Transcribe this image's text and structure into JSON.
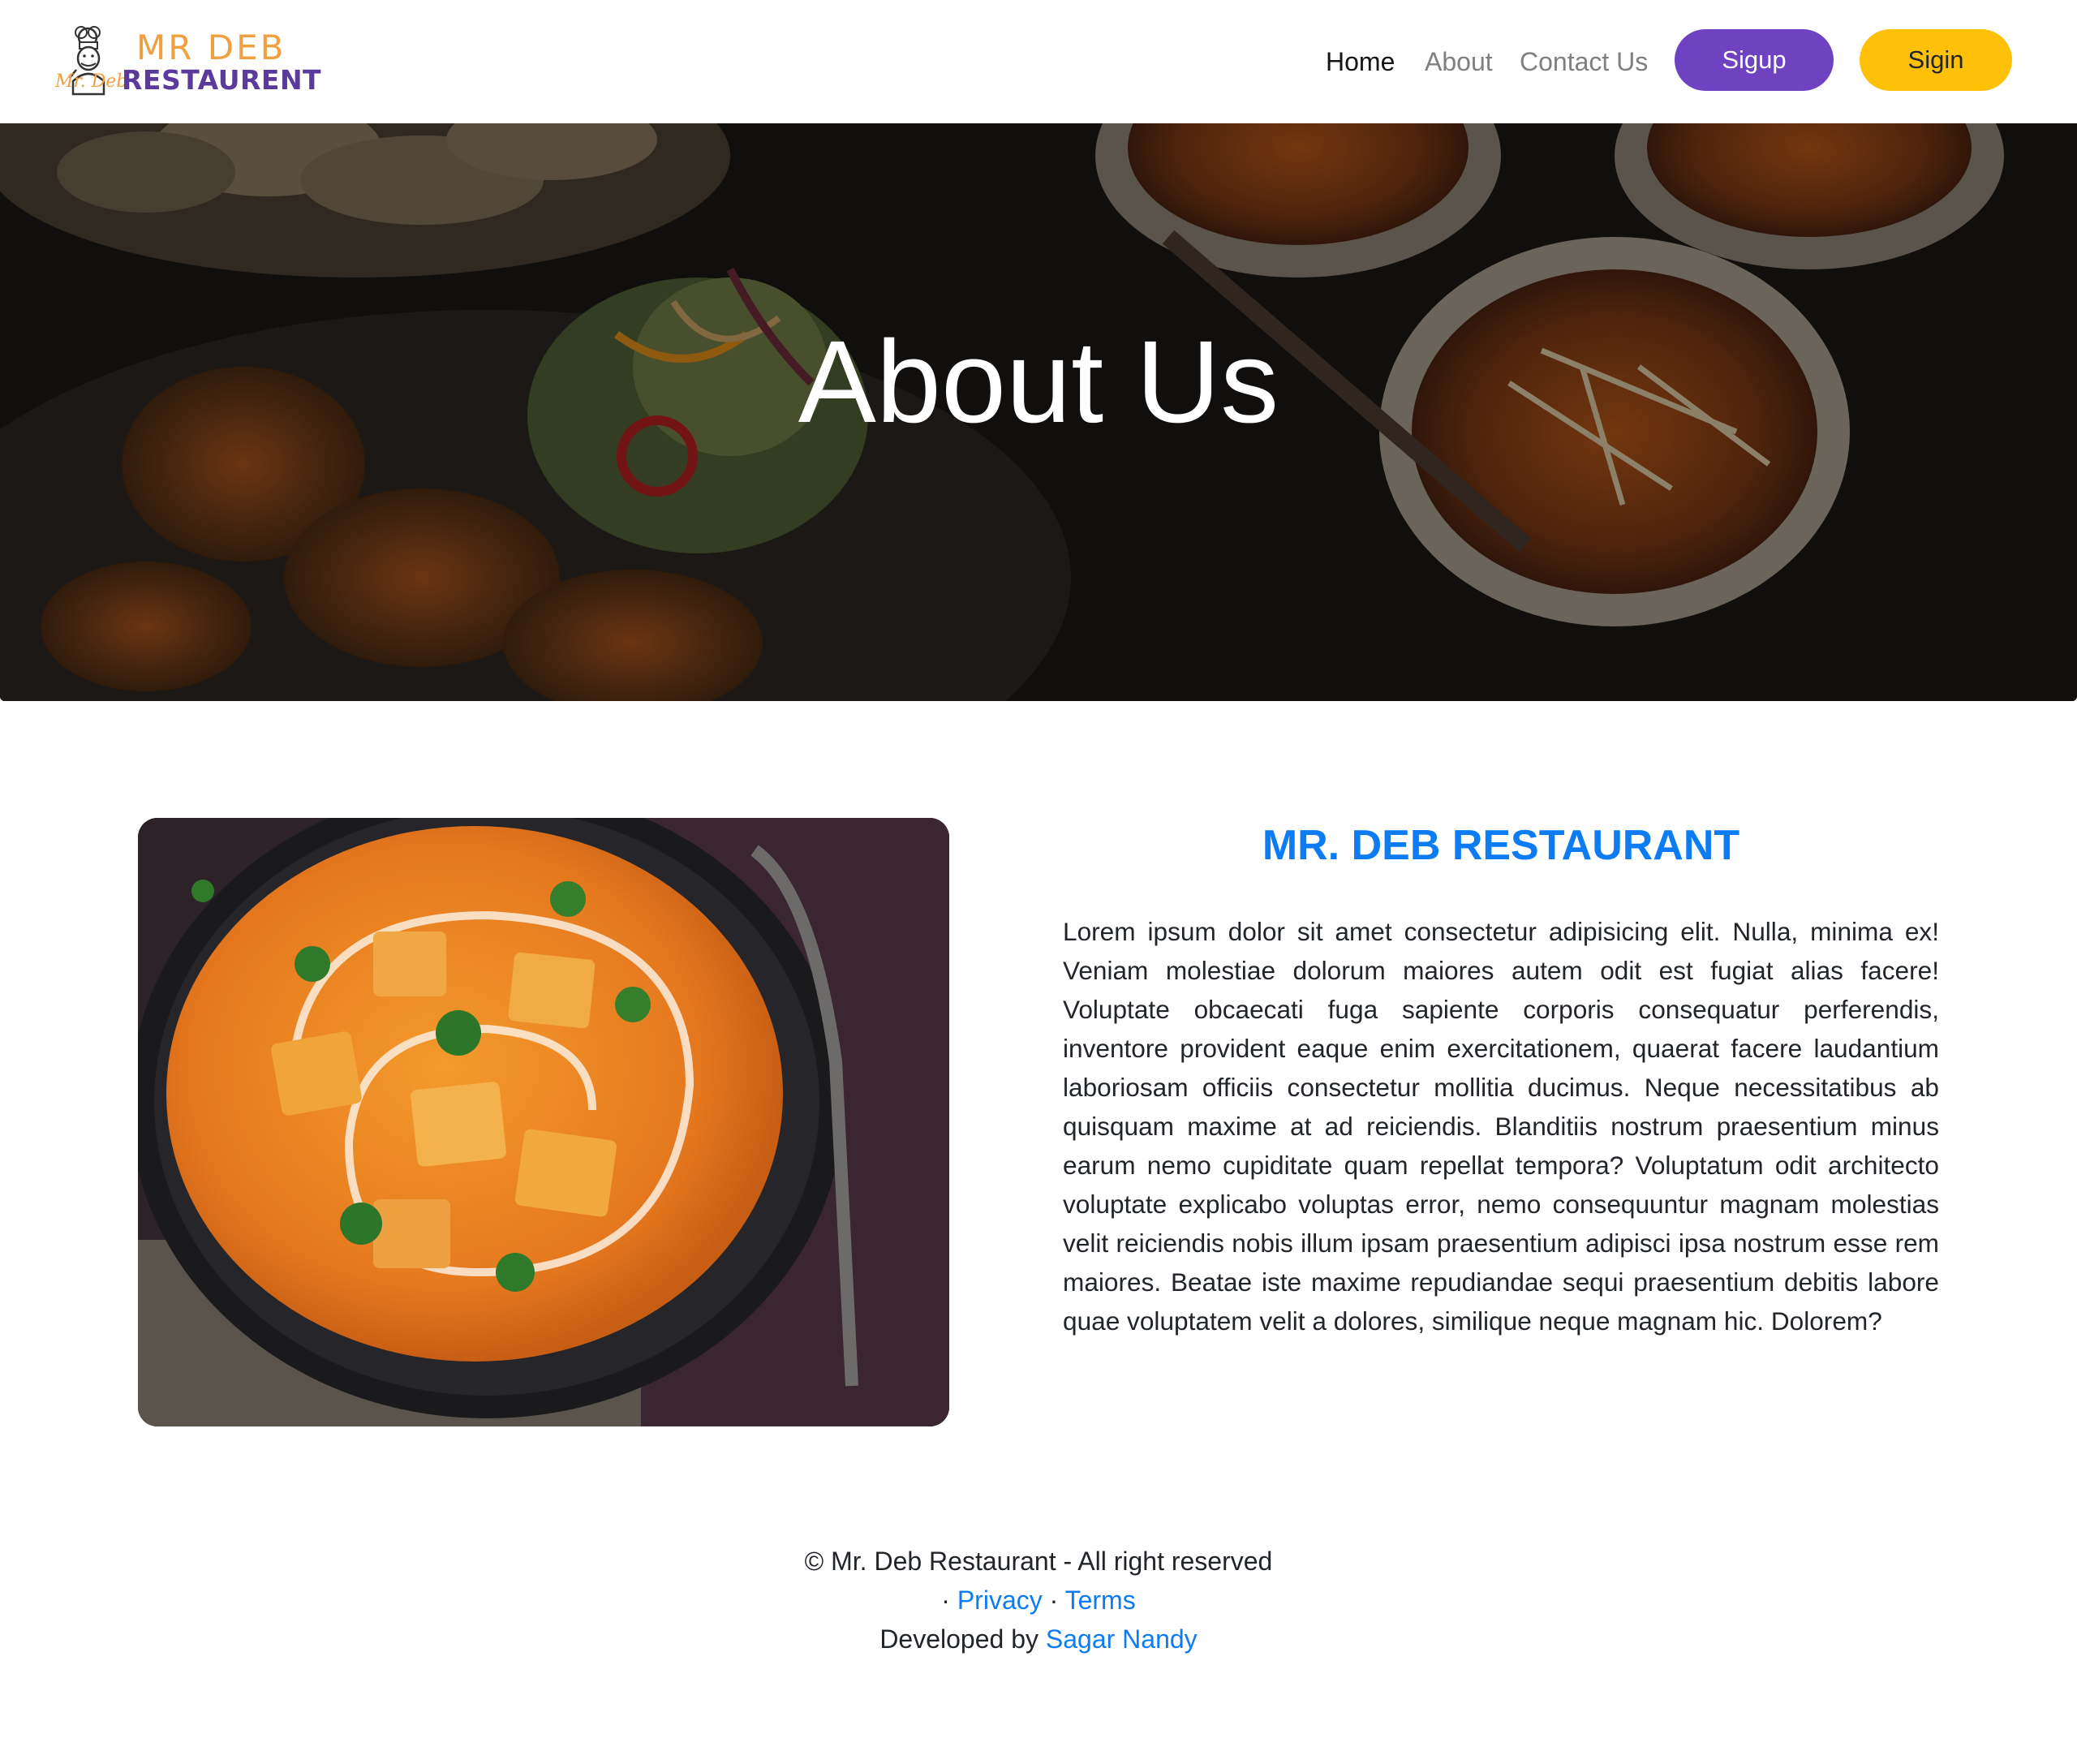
{
  "brand": {
    "line1": "MR DEB",
    "line2": "RESTAURENT",
    "script": "Mr. Deb"
  },
  "nav": {
    "home": "Home",
    "about": "About",
    "contact": "Contact Us",
    "signup": "Sigup",
    "signin": "Sigin"
  },
  "hero": {
    "title": "About Us"
  },
  "about": {
    "heading": "MR. DEB RESTAURANT",
    "body": "Lorem ipsum dolor sit amet consectetur adipisicing elit. Nulla, minima ex! Veniam molestiae dolorum maiores autem odit est fugiat alias facere! Voluptate obcaecati fuga sapiente corporis consequatur perferendis, inventore provident eaque enim exercitationem, quaerat facere laudantium laboriosam officiis consectetur mollitia ducimus. Neque necessitatibus ab quisquam maxime at ad reiciendis. Blanditiis nostrum praesentium minus earum nemo cupiditate quam repellat tempora? Voluptatum odit architecto voluptate explicabo voluptas error, nemo consequuntur magnam molestias velit reiciendis nobis illum ipsam praesentium adipisci ipsa nostrum esse rem maiores. Beatae iste maxime repudiandae sequi praesentium debitis labore quae voluptatem velit a dolores, similique neque magnam hic. Dolorem?"
  },
  "footer": {
    "copyright": "© Mr. Deb Restaurant - All right reserved",
    "separator": "·",
    "privacy": "Privacy",
    "terms": "Terms",
    "developed_by": "Developed by",
    "developer": "Sagar Nandy"
  },
  "colors": {
    "brand_orange": "#f0a040",
    "brand_purple": "#5a3b9b",
    "signup_button": "#6f42c1",
    "signin_button": "#ffc107",
    "link_blue": "#0d7cf2"
  }
}
